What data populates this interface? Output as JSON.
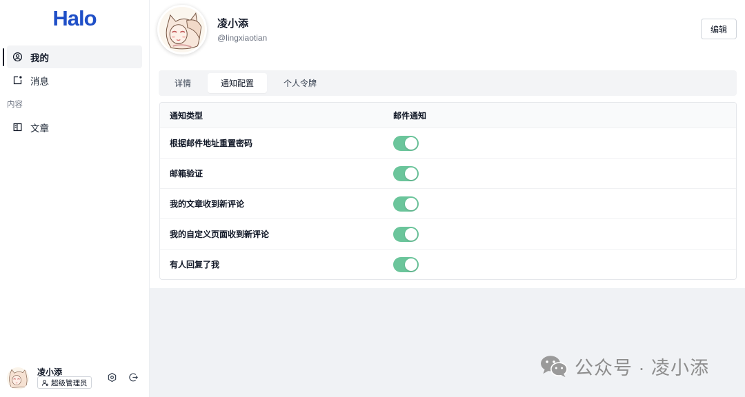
{
  "brand": {
    "logo": "Halo"
  },
  "sidebar": {
    "items": [
      {
        "label": "我的",
        "icon": "user-circle-icon",
        "active": true
      },
      {
        "label": "消息",
        "icon": "notification-badge-icon",
        "active": false
      }
    ],
    "sections": [
      {
        "title": "内容",
        "items": [
          {
            "label": "文章",
            "icon": "article-layout-icon",
            "active": false
          }
        ]
      }
    ],
    "current_user": {
      "name": "凌小添",
      "role": "超级管理员",
      "role_icon": "user-settings-icon",
      "actions": [
        {
          "icon": "gear-icon"
        },
        {
          "icon": "logout-icon"
        }
      ]
    }
  },
  "profile": {
    "display_name": "凌小添",
    "username": "@lingxiaotian",
    "edit_label": "编辑"
  },
  "tabs": [
    {
      "label": "详情",
      "active": false
    },
    {
      "label": "通知配置",
      "active": true
    },
    {
      "label": "个人令牌",
      "active": false
    }
  ],
  "notification_settings": {
    "columns": {
      "type": "通知类型",
      "email": "邮件通知"
    },
    "rows": [
      {
        "type": "根据邮件地址重置密码",
        "email_enabled": true
      },
      {
        "type": "邮箱验证",
        "email_enabled": true
      },
      {
        "type": "我的文章收到新评论",
        "email_enabled": true
      },
      {
        "type": "我的自定义页面收到新评论",
        "email_enabled": true
      },
      {
        "type": "有人回复了我",
        "email_enabled": true
      }
    ]
  },
  "watermark": {
    "icon": "wechat-icon",
    "text": "公众号 · 凌小添"
  },
  "colors": {
    "brand": "#1f4fc7",
    "toggle_on": "#6bc59b",
    "active_indicator": "#111827",
    "page_bg": "#f0f2f5"
  }
}
